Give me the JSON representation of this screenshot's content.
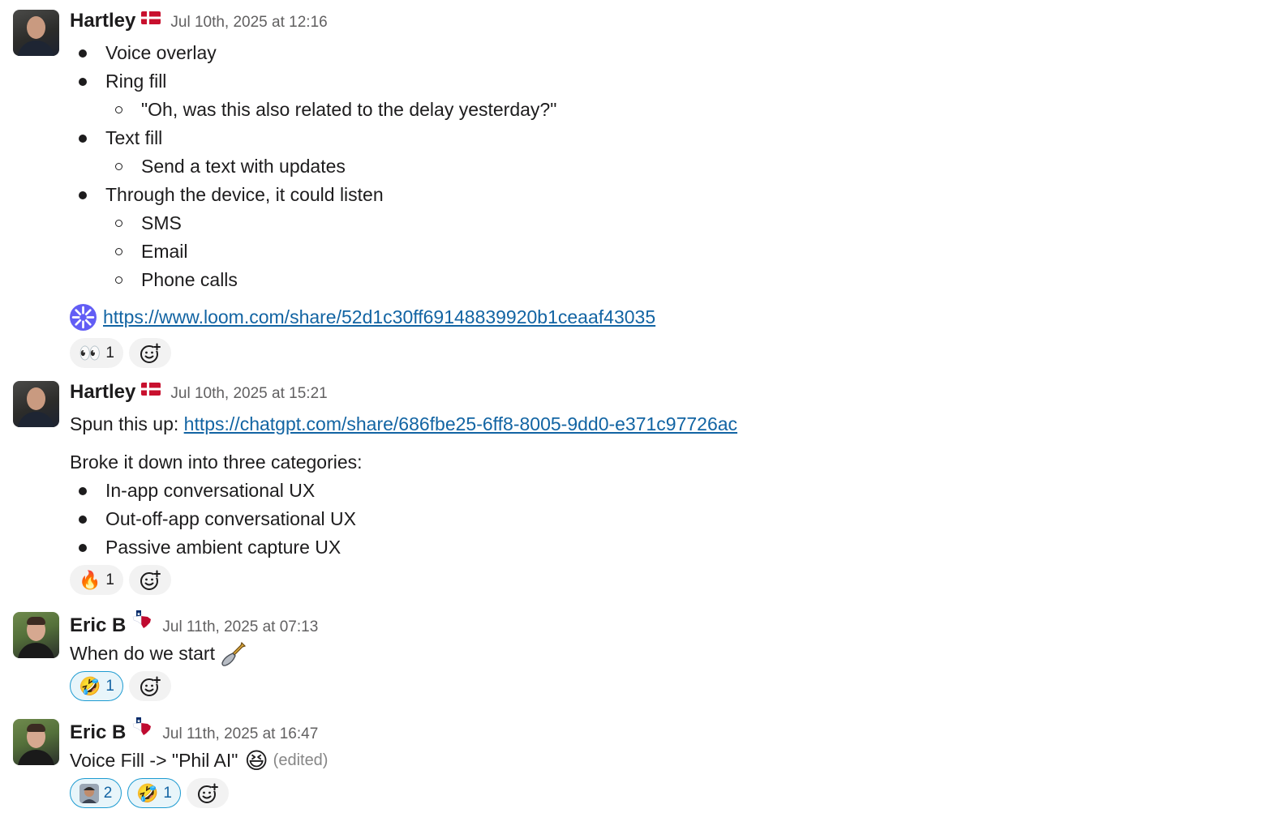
{
  "messages": [
    {
      "author": "Hartley",
      "flag": "denmark-flag",
      "timestamp": "Jul 10th, 2025 at 12:16",
      "bullets": [
        {
          "text": "Voice overlay",
          "sub": []
        },
        {
          "text": "Ring fill",
          "sub": [
            "\"Oh, was this also related to the delay yesterday?\""
          ]
        },
        {
          "text": "Text fill",
          "sub": [
            "Send a text with updates"
          ]
        },
        {
          "text": "Through the device, it could listen",
          "sub": [
            "SMS",
            "Email",
            "Phone calls"
          ]
        }
      ],
      "link": "https://www.loom.com/share/52d1c30ff69148839920b1ceaaf43035",
      "reactions": [
        {
          "emoji": "👀",
          "count": "1"
        }
      ]
    },
    {
      "author": "Hartley",
      "flag": "denmark-flag",
      "timestamp": "Jul 10th, 2025 at 15:21",
      "intro": "Spun this up:",
      "link": "https://chatgpt.com/share/686fbe25-6ff8-8005-9dd0-e371c97726ac",
      "body": "Broke it down into three categories:",
      "bullets": [
        "In-app conversational UX",
        "Out-off-app conversational UX",
        "Passive ambient capture UX"
      ],
      "reactions": [
        {
          "emoji": "🔥",
          "count": "1"
        }
      ]
    },
    {
      "author": "Eric B",
      "flag": "texas-flag",
      "timestamp": "Jul 11th, 2025 at 07:13",
      "text": "When do we start",
      "text_emoji": "shovel-icon",
      "reactions": [
        {
          "emoji": "🤣",
          "count": "1"
        }
      ]
    },
    {
      "author": "Eric B",
      "flag": "texas-flag",
      "timestamp": "Jul 11th, 2025 at 16:47",
      "text": "Voice Fill -> \"Phil AI\"",
      "text_emoji": "😆",
      "edited": "(edited)",
      "reactions": [
        {
          "emoji": "custom-avatar-emoji",
          "count": "2"
        },
        {
          "emoji": "🤣",
          "count": "1"
        }
      ]
    }
  ],
  "colors": {
    "link": "#1264a3",
    "selected_reaction_border": "#1d9bd1",
    "timestamp": "#616061"
  }
}
